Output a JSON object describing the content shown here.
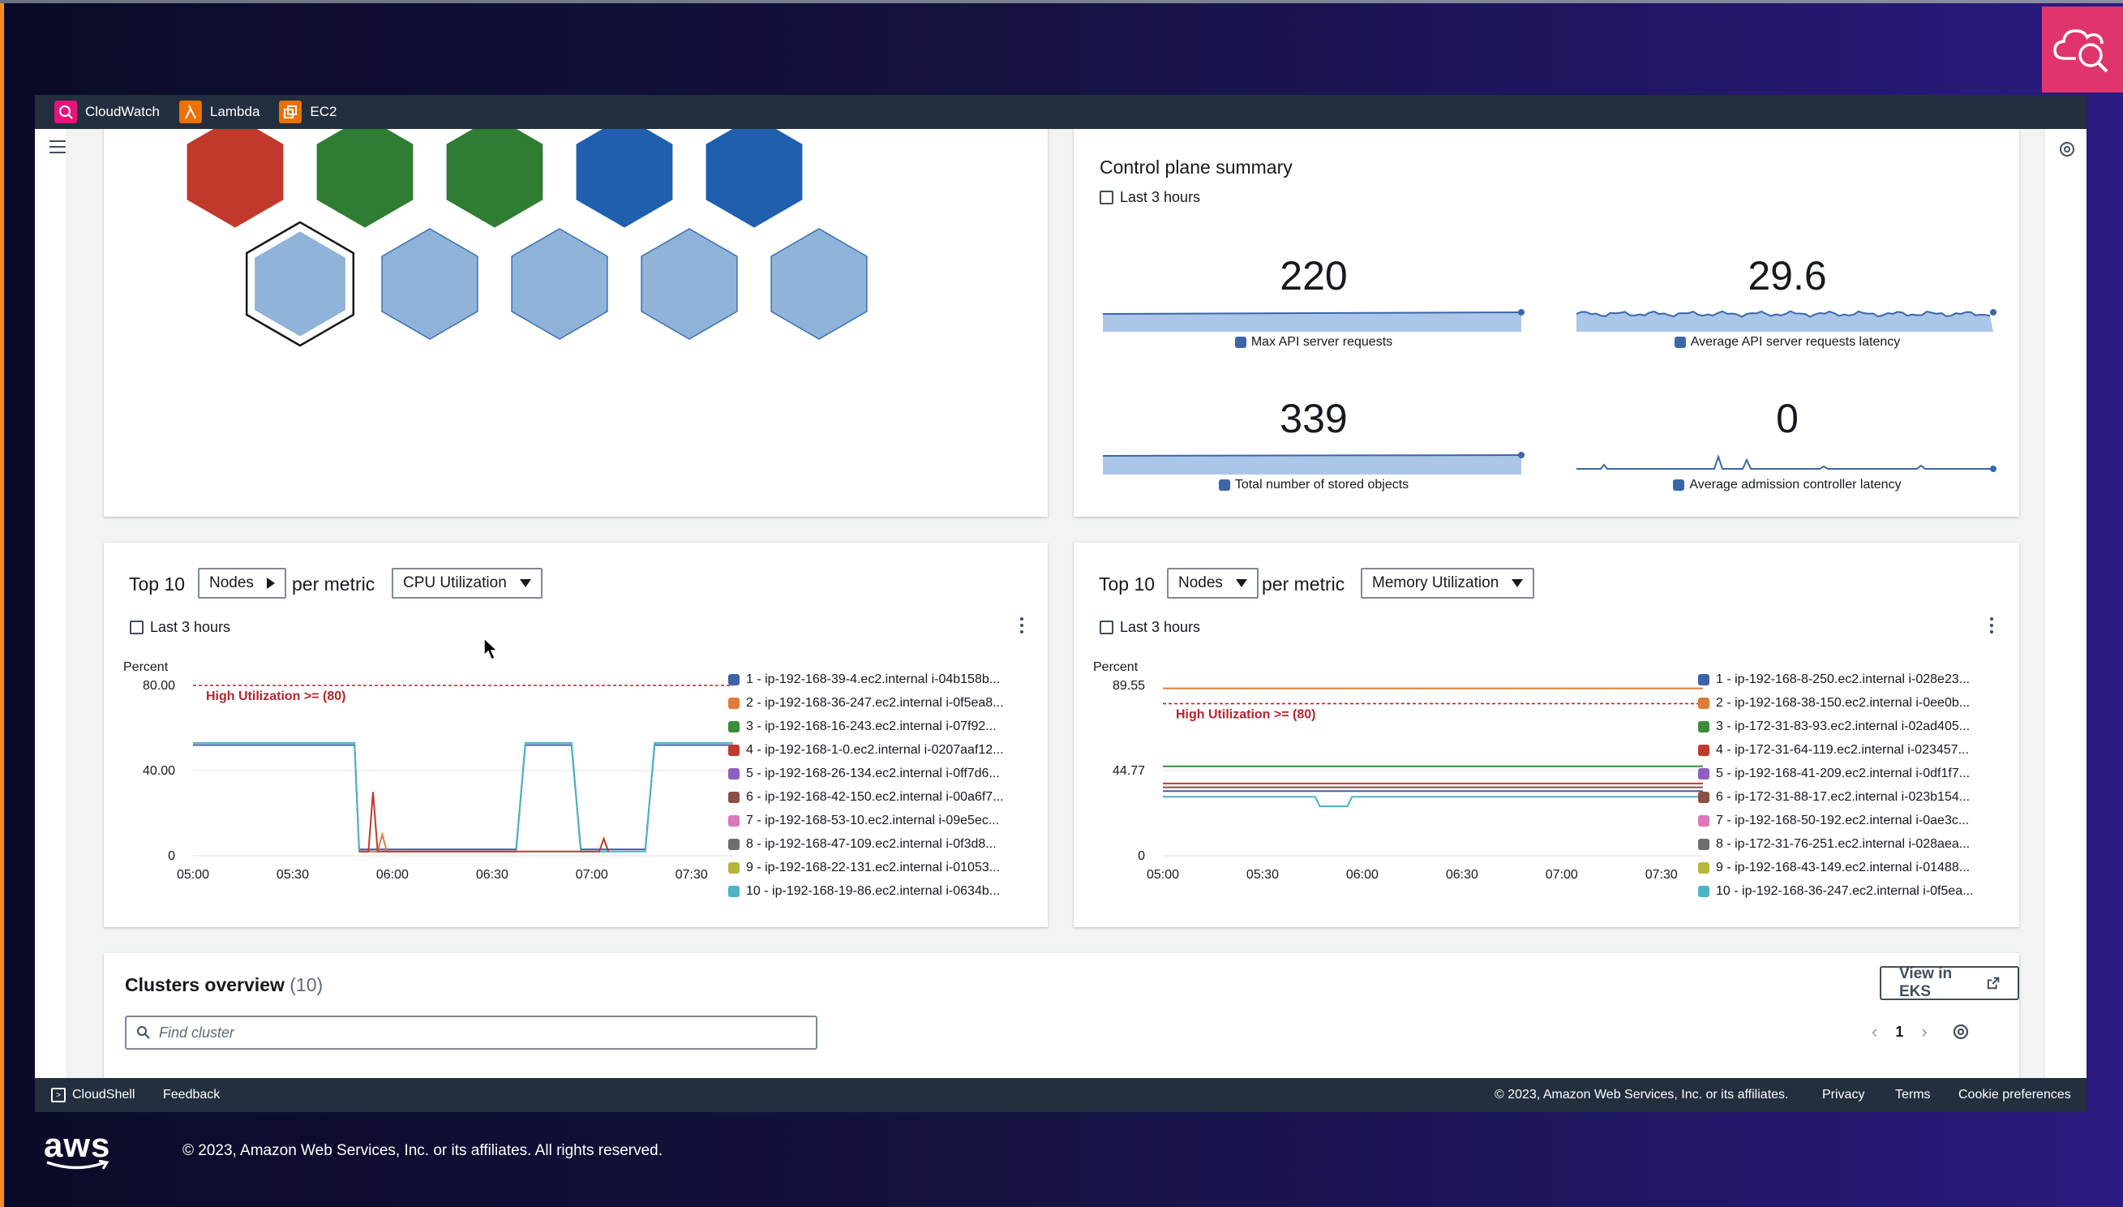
{
  "services": [
    {
      "label": "CloudWatch",
      "icon": "cloudwatch-icon",
      "color": "#e7157b"
    },
    {
      "label": "Lambda",
      "icon": "lambda-icon",
      "color": "#ed7100"
    },
    {
      "label": "EC2",
      "icon": "ec2-icon",
      "color": "#ed7100"
    }
  ],
  "hexmap": {
    "row1_colors": [
      "#c0392b",
      "#2e7d32",
      "#2e7d32",
      "#1f5fae",
      "#1f5fae"
    ],
    "row2_colors": [
      "#8fb3d9",
      "#8fb3d9",
      "#8fb3d9",
      "#8fb3d9",
      "#8fb3d9"
    ],
    "selected_index": 0
  },
  "control_plane": {
    "title": "Control plane summary",
    "timeframe": "Last 3 hours",
    "metrics": [
      {
        "value": "220",
        "label": "Max API server requests",
        "color": "#3b66a8"
      },
      {
        "value": "29.6",
        "label": "Average API server requests latency",
        "color": "#3b66a8"
      },
      {
        "value": "339",
        "label": "Total number of stored objects",
        "color": "#3b66a8"
      },
      {
        "value": "0",
        "label": "Average admission controller latency",
        "color": "#3b66a8"
      }
    ]
  },
  "top_cpu": {
    "prefix": "Top 10",
    "dropdown1": "Nodes",
    "middle": "per metric",
    "dropdown2": "CPU Utilization",
    "timeframe": "Last 3 hours",
    "menu_icon": "more-vertical-icon",
    "legend": [
      {
        "label": "1 - ip-192-168-39-4.ec2.internal i-04b158b...",
        "color": "#3d62a8"
      },
      {
        "label": "2 - ip-192-168-36-247.ec2.internal i-0f5ea8...",
        "color": "#e07b39"
      },
      {
        "label": "3 - ip-192-168-16-243.ec2.internal i-07f92...",
        "color": "#3c8d3a"
      },
      {
        "label": "4 - ip-192-168-1-0.ec2.internal i-0207aaf12...",
        "color": "#c0392b"
      },
      {
        "label": "5 - ip-192-168-26-134.ec2.internal i-0ff7d6...",
        "color": "#8e5fc2"
      },
      {
        "label": "6 - ip-192-168-42-150.ec2.internal i-00a6f7...",
        "color": "#8d4f44"
      },
      {
        "label": "7 - ip-192-168-53-10.ec2.internal i-09e5ec...",
        "color": "#dc78b8"
      },
      {
        "label": "8 - ip-192-168-47-109.ec2.internal i-0f3d8...",
        "color": "#6e6e6e"
      },
      {
        "label": "9 - ip-192-168-22-131.ec2.internal i-01053...",
        "color": "#b5b63c"
      },
      {
        "label": "10 - ip-192-168-19-86.ec2.internal i-0634b...",
        "color": "#4bb3c4"
      }
    ]
  },
  "top_mem": {
    "prefix": "Top 10",
    "dropdown1": "Nodes",
    "middle": "per metric",
    "dropdown2": "Memory Utilization",
    "timeframe": "Last 3 hours",
    "menu_icon": "more-vertical-icon",
    "legend": [
      {
        "label": "1 - ip-192-168-8-250.ec2.internal i-028e23...",
        "color": "#3d62a8"
      },
      {
        "label": "2 - ip-192-168-38-150.ec2.internal i-0ee0b...",
        "color": "#e07b39"
      },
      {
        "label": "3 - ip-172-31-83-93.ec2.internal i-02ad405...",
        "color": "#3c8d3a"
      },
      {
        "label": "4 - ip-172-31-64-119.ec2.internal i-023457...",
        "color": "#c0392b"
      },
      {
        "label": "5 - ip-192-168-41-209.ec2.internal i-0df1f7...",
        "color": "#8e5fc2"
      },
      {
        "label": "6 - ip-172-31-88-17.ec2.internal i-023b154...",
        "color": "#8d4f44"
      },
      {
        "label": "7 - ip-192-168-50-192.ec2.internal i-0ae3c...",
        "color": "#dc78b8"
      },
      {
        "label": "8 - ip-172-31-76-251.ec2.internal i-028aea...",
        "color": "#6e6e6e"
      },
      {
        "label": "9 - ip-192-168-43-149.ec2.internal i-01488...",
        "color": "#b5b63c"
      },
      {
        "label": "10 - ip-192-168-36-247.ec2.internal i-0f5ea...",
        "color": "#4bb3c4"
      }
    ]
  },
  "chart_data": [
    {
      "type": "line",
      "ylabel": "Percent",
      "ylim": [
        0,
        80
      ],
      "y_ticks": [
        "80.00",
        "40.00",
        "0"
      ],
      "x": [
        "05:00",
        "05:30",
        "06:00",
        "06:30",
        "07:00",
        "07:30"
      ],
      "threshold": {
        "value": 80,
        "label": "High Utilization >= (80)",
        "color": "#b3262d"
      },
      "series": [
        {
          "name": "1 - ip-192-168-39-4.ec2.internal i-04b158b...",
          "points": [
            [
              0,
              52
            ],
            [
              35,
              52
            ],
            [
              36,
              3
            ],
            [
              70,
              3
            ],
            [
              72,
              52
            ],
            [
              82,
              52
            ],
            [
              84,
              3
            ],
            [
              98,
              3
            ],
            [
              100,
              52
            ],
            [
              117,
              52
            ]
          ]
        },
        {
          "name": "10 - ip-192-168-19-86.ec2.internal i-0634b...",
          "points": [
            [
              0,
              53
            ],
            [
              35,
              53
            ],
            [
              36,
              2
            ],
            [
              70,
              2
            ],
            [
              72,
              53
            ],
            [
              82,
              53
            ],
            [
              84,
              2
            ],
            [
              98,
              2
            ],
            [
              100,
              53
            ],
            [
              117,
              53
            ]
          ]
        },
        {
          "name": "2 - ip-192-168-36-247.ec2.internal i-0f5ea8...",
          "points": [
            [
              36,
              2
            ],
            [
              40,
              2
            ],
            [
              41,
              10
            ],
            [
              42,
              2
            ],
            [
              70,
              2
            ]
          ]
        },
        {
          "name": "4 - ip-192-168-1-0.ec2.internal i-0207aaf12...",
          "points": [
            [
              36,
              2
            ],
            [
              38,
              2
            ],
            [
              39,
              30
            ],
            [
              40,
              2
            ],
            [
              88,
              2
            ],
            [
              89,
              8
            ],
            [
              90,
              2
            ]
          ]
        }
      ]
    },
    {
      "type": "line",
      "ylabel": "Percent",
      "ylim": [
        0,
        89.55
      ],
      "y_ticks": [
        "89.55",
        "44.77",
        "0"
      ],
      "x": [
        "05:00",
        "05:30",
        "06:00",
        "06:30",
        "07:00",
        "07:30"
      ],
      "threshold": {
        "value": 80,
        "label": "High Utilization >= (80)",
        "color": "#b3262d"
      },
      "series": [
        {
          "name": "2 - ip-192-168-38-150.ec2.internal i-0ee0b...",
          "points": [
            [
              0,
              88
            ],
            [
              117,
              88
            ]
          ]
        },
        {
          "name": "3 - ip-172-31-83-93.ec2.internal i-02ad405...",
          "points": [
            [
              0,
              47
            ],
            [
              117,
              47
            ]
          ]
        },
        {
          "name": "4 - ip-172-31-64-119.ec2.internal i-023457...",
          "points": [
            [
              0,
              38
            ],
            [
              117,
              38
            ]
          ]
        },
        {
          "name": "6 - ip-172-31-88-17.ec2.internal i-023b154...",
          "points": [
            [
              0,
              36
            ],
            [
              117,
              36
            ]
          ]
        },
        {
          "name": "1 - ip-192-168-8-250.ec2.internal i-028e23...",
          "points": [
            [
              0,
              34
            ],
            [
              117,
              34
            ]
          ]
        },
        {
          "name": "10 - ip-192-168-36-247.ec2.internal i-0f5ea...",
          "points": [
            [
              0,
              31
            ],
            [
              33,
              31
            ],
            [
              34,
              26
            ],
            [
              40,
              26
            ],
            [
              41,
              31
            ],
            [
              117,
              31
            ]
          ]
        }
      ]
    }
  ],
  "clusters": {
    "title": "Clusters overview",
    "count": "(10)",
    "view_button": "View in EKS",
    "search_placeholder": "Find cluster",
    "page": "1"
  },
  "footer": {
    "cloudshell": "CloudShell",
    "feedback": "Feedback",
    "copyright": "© 2023, Amazon Web Services, Inc. or its affiliates.",
    "privacy": "Privacy",
    "terms": "Terms",
    "cookies": "Cookie preferences"
  },
  "outer_footer": {
    "aws_logo_text": "aws",
    "copyright": "© 2023, Amazon Web Services, Inc. or its affiliates. All rights reserved."
  }
}
